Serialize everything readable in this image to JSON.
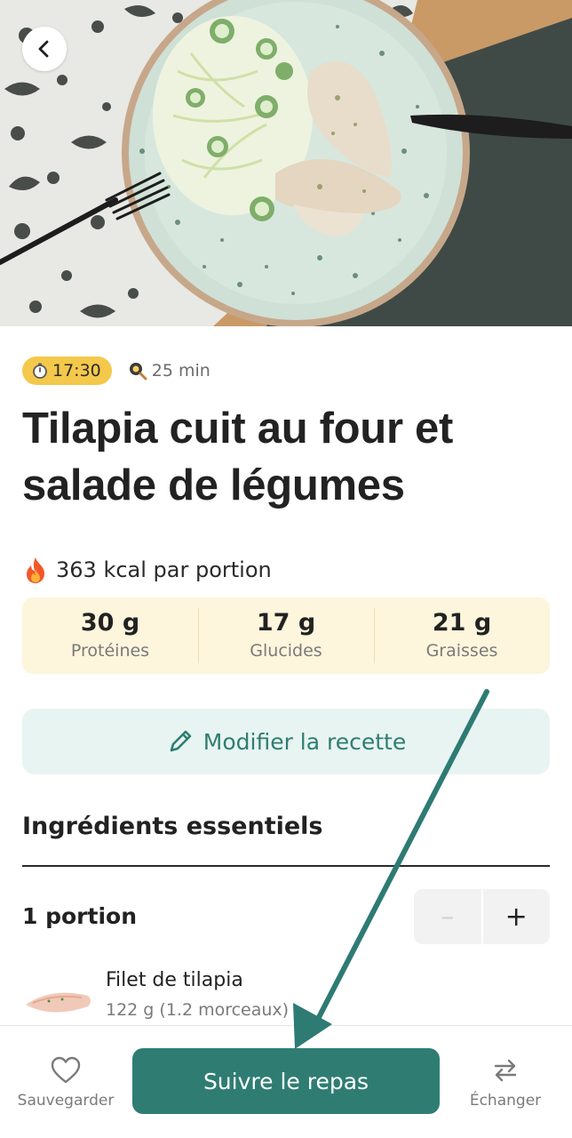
{
  "hero": {
    "image": "baked-tilapia-salad-plate-photo"
  },
  "meta": {
    "time": "17:30",
    "duration": "25 min"
  },
  "recipe": {
    "title_line1": "Tilapia cuit au four et",
    "title_line2": "salade de légumes",
    "kcal": "363 kcal par portion"
  },
  "macros": [
    {
      "value": "30 g",
      "label": "Protéines"
    },
    {
      "value": "17 g",
      "label": "Glucides"
    },
    {
      "value": "21 g",
      "label": "Graisses"
    }
  ],
  "edit_label": "Modifier la recette",
  "ingredients_section": {
    "title": "Ingrédients essentiels",
    "portion_label": "1 portion",
    "minus": "–",
    "plus": "+",
    "items": [
      {
        "name": "Filet de tilapia",
        "qty": "122 g (1.2 morceaux)"
      }
    ]
  },
  "bottom": {
    "save_label": "Sauvegarder",
    "follow_label": "Suivre le repas",
    "swap_label": "Échanger"
  },
  "colors": {
    "accent": "#2f7d72",
    "badge": "#f4c84a",
    "macro_bg": "#fdf5dc",
    "edit_bg": "#e8f4f1"
  },
  "icons": {
    "back": "chevron-left-icon",
    "timer": "stopwatch-icon",
    "cook": "frying-pan-icon",
    "calories": "fire-icon",
    "edit": "pencil-icon",
    "save": "heart-icon",
    "swap": "swap-arrows-icon"
  }
}
